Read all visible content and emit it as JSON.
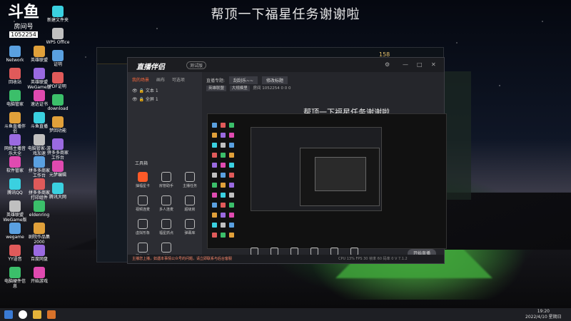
{
  "banner": "帮顶一下福星任务谢谢啦",
  "watermark": {
    "brand": "斗鱼",
    "room_label": "房间号",
    "room_id": "1052254"
  },
  "desktop_icons": [
    {
      "label": "Network"
    },
    {
      "label": "回收站"
    },
    {
      "label": "电脑管家"
    },
    {
      "label": "斗鱼直播伴侣"
    },
    {
      "label": "网络主播音乐大全"
    },
    {
      "label": "软件管家"
    },
    {
      "label": "腾讯QQ"
    },
    {
      "label": "英雄联盟 WeGame版"
    },
    {
      "label": "wegame"
    },
    {
      "label": "YY语音"
    },
    {
      "label": "电脑硬件信息"
    },
    {
      "label": "英雄联盟"
    },
    {
      "label": "英雄联盟 WeGame版"
    },
    {
      "label": "速达证书"
    },
    {
      "label": "斗鱼直播"
    },
    {
      "label": "电脑管家-游戏加速"
    },
    {
      "label": "拼多多商家工作台"
    },
    {
      "label": "拼多多商家打印组件"
    },
    {
      "label": "eldenring"
    },
    {
      "label": "剧院作品集 2000"
    },
    {
      "label": "百度网盘"
    },
    {
      "label": "开始游戏"
    },
    {
      "label": "新建文件夹"
    },
    {
      "label": "WPS Office"
    },
    {
      "label": "证明"
    },
    {
      "label": "PDF证明"
    },
    {
      "label": "download"
    },
    {
      "label": "梦回功能"
    },
    {
      "label": "拼多多商家工作台"
    },
    {
      "label": "元梦编辑"
    },
    {
      "label": "腾讯大网"
    }
  ],
  "lol_client": {
    "level": "158"
  },
  "obs": {
    "title": "直播伴侣",
    "badge": "测试版",
    "tabs": [
      {
        "label": "我的场景",
        "active": true
      },
      {
        "label": "画布",
        "active": false
      },
      {
        "label": "可选项",
        "active": false
      }
    ],
    "scenes": [
      "文本 1",
      "全屏 1"
    ],
    "tools_label": "工具箱",
    "tools": [
      {
        "label": "抽福星卡",
        "hot": true
      },
      {
        "label": "房管助手"
      },
      {
        "label": "主播任务"
      },
      {
        "label": "视频连麦"
      },
      {
        "label": "多人连麦"
      },
      {
        "label": "超级房"
      },
      {
        "label": "虚拟形象"
      },
      {
        "label": "福星抓点"
      },
      {
        "label": "弹幕库"
      },
      {
        "label": "更多工具"
      },
      {
        "label": "任务"
      }
    ],
    "topic_label": "直播专题:",
    "topic_value": "刮刮乐~~",
    "topic_edit": "修改标题",
    "game_tag": "英雄联盟",
    "area_tag": "大规模里",
    "room_label": "房间",
    "room_id": "1052254",
    "counts": [
      "0",
      "0",
      "0"
    ],
    "preview_title": "帮顶一下福星任务谢谢啦",
    "controls": [
      {
        "label": "直播屏幕"
      },
      {
        "label": "摄像头"
      },
      {
        "label": "手机投屏"
      },
      {
        "label": "多媒体"
      },
      {
        "label": "麦克风"
      },
      {
        "label": "扬声器"
      }
    ],
    "go_live": "开始直播",
    "status_tip": "主播您上播，如遇本事情公众号的问题，请立即联系与后台客服",
    "stats": [
      "CPU 13%",
      "FPS 30",
      "帧率 60",
      "码率 0"
    ],
    "version": "V 7.1.2"
  },
  "taskbar": {
    "time": "19:20",
    "date": "2022/4/10 星期日"
  }
}
